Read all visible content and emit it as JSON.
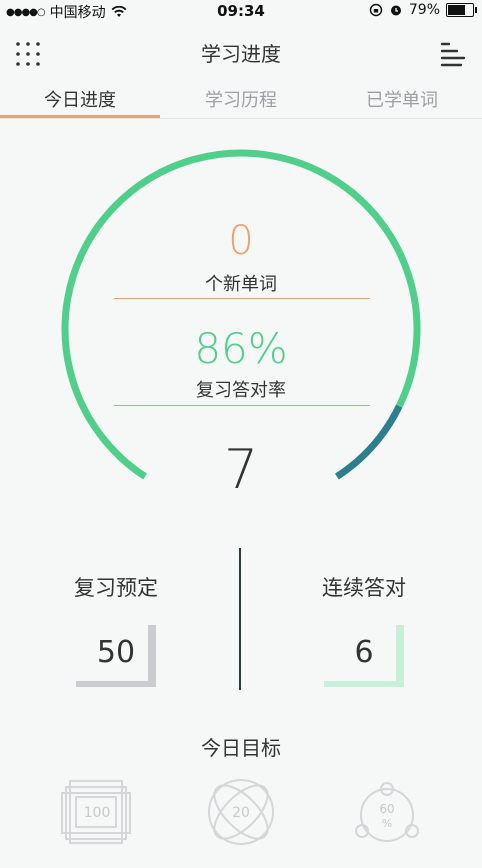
{
  "status_bar": {
    "signal_dots": "●●●●○",
    "carrier": "中国移动",
    "wifi_icon": "wifi-icon",
    "time": "09:34",
    "battery": "79%",
    "battery_level": 0.79
  },
  "header": {
    "title": "学习进度",
    "left_icon": "apps-grid-icon",
    "right_icon": "menu-icon"
  },
  "tabs": [
    {
      "label": "今日进度",
      "active": true
    },
    {
      "label": "学习历程",
      "active": false
    },
    {
      "label": "已学单词",
      "active": false
    }
  ],
  "progress": {
    "new_words_count": "0",
    "new_words_label": "个新单词",
    "review_rate": "86%",
    "review_rate_label": "复习答对率",
    "day_number": "7",
    "ring_accent_color": "#4fcf8a",
    "ring_secondary_color": "#2f7e8e",
    "new_color": "#f2a06b"
  },
  "stats": {
    "review_scheduled_label": "复习预定",
    "review_scheduled_value": "50",
    "streak_label": "连续答对",
    "streak_value": "6"
  },
  "goals": {
    "title": "今日目标",
    "icons": [
      {
        "name": "goal-100-words-icon",
        "text": "100"
      },
      {
        "name": "goal-20-icon",
        "text": "20"
      },
      {
        "name": "goal-60-percent-icon",
        "text": "60",
        "sub": "%"
      }
    ]
  }
}
